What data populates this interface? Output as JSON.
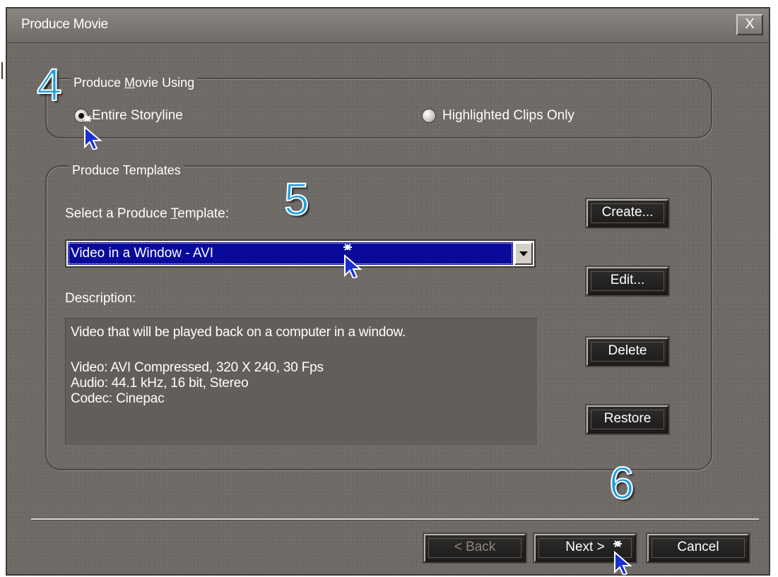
{
  "window": {
    "title": "Produce Movie",
    "close_label": "X"
  },
  "produce_using": {
    "group_label": "Produce Movie Using",
    "options": [
      {
        "label": "Entire Storyline",
        "checked": true
      },
      {
        "label": "Highlighted Clips Only",
        "checked": false
      }
    ]
  },
  "templates": {
    "group_label": "Produce Templates",
    "select_label": "Select a Produce Template:",
    "selected_value": "Video in a Window - AVI",
    "description_label": "Description:",
    "description_lines": [
      "Video that will be played back on a computer in a window.",
      "Video:  AVI Compressed, 320 X 240, 30 Fps",
      "Audio:  44.1 kHz, 16 bit, Stereo",
      "Codec: Cinepac"
    ],
    "buttons": {
      "create": "Create...",
      "edit": "Edit...",
      "delete": "Delete",
      "restore": "Restore"
    }
  },
  "footer": {
    "back": "< Back",
    "next": "Next >",
    "cancel": "Cancel"
  },
  "annotations": {
    "step4": "4",
    "step5": "5",
    "step6": "6"
  },
  "colors": {
    "dialog_bg": "#6e6a66",
    "selection": "#0a0a9a",
    "step_number": "#1f9ee0"
  }
}
